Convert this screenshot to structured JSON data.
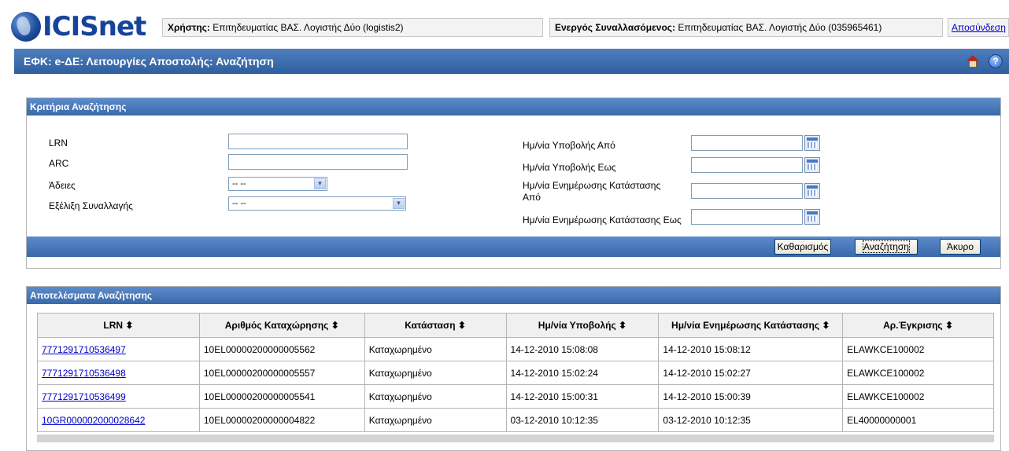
{
  "app": {
    "logo_text": "ICISnet"
  },
  "header": {
    "user_label": "Χρήστης:",
    "user_value": "Επιτηδευματίας ΒΑΣ. Λογιστής Δύο (logistis2)",
    "active_label": "Ενεργός Συναλλασόμενος:",
    "active_value": "Επιτηδευματίας ΒΑΣ. Λογιστής Δύο (035965461)",
    "logout": "Αποσύνδεση"
  },
  "page": {
    "title": "ΕΦΚ: e-ΔΕ: Λειτουργίες Αποστολής: Αναζήτηση",
    "help_glyph": "?"
  },
  "criteria": {
    "header": "Κριτήρια Αναζήτησης",
    "lrn_label": "LRN",
    "arc_label": "ARC",
    "permits_label": "Άδειες",
    "permits_value": "-- --",
    "progress_label": "Εξέλιξη Συναλλαγής",
    "progress_value": "-- --",
    "sub_from_label": "Ημ/νία Υποβολής Από",
    "sub_to_label": "Ημ/νία Υποβολής Εως",
    "upd_from_label_line1": "Ημ/νία Ενημέρωσης Κατάστασης",
    "upd_from_label_line2": "Από",
    "upd_to_label": "Ημ/νία Ενημέρωσης Κατάστασης Εως",
    "clear_button": "Καθαρισμός",
    "search_button": "Αναζήτηση",
    "cancel_button": "Άκυρο"
  },
  "results": {
    "header": "Αποτελέσματα Αναζήτησης",
    "columns": [
      "LRN ⬍",
      "Αριθμός Καταχώρησης ⬍",
      "Κατάσταση ⬍",
      "Ημ/νία Υποβολής ⬍",
      "Ημ/νία Ενημέρωσης Κατάστασης ⬍",
      "Αρ.Έγκρισης ⬍"
    ],
    "rows": [
      [
        "7771291710536497",
        "10EL00000200000005562",
        "Καταχωρημένο",
        "14-12-2010 15:08:08",
        "14-12-2010 15:08:12",
        "ELAWKCE100002"
      ],
      [
        "7771291710536498",
        "10EL00000200000005557",
        "Καταχωρημένο",
        "14-12-2010 15:02:24",
        "14-12-2010 15:02:27",
        "ELAWKCE100002"
      ],
      [
        "7771291710536499",
        "10EL00000200000005541",
        "Καταχωρημένο",
        "14-12-2010 15:00:31",
        "14-12-2010 15:00:39",
        "ELAWKCE100002"
      ],
      [
        "10GR000002000028642",
        "10EL00000200000004822",
        "Καταχωρημένο",
        "03-12-2010 10:12:35",
        "03-12-2010 10:12:35",
        "EL40000000001"
      ]
    ]
  }
}
